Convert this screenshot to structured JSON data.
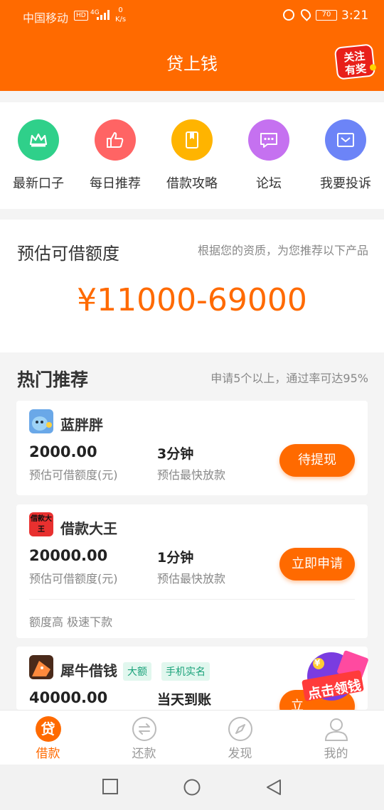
{
  "status_bar": {
    "carrier": "中国移动",
    "hd": "HD",
    "network": "4G",
    "speed_value": "0",
    "speed_unit": "K/s",
    "battery": "70",
    "time": "3:21"
  },
  "header": {
    "title": "贷上钱",
    "follow_badge_line1": "关注",
    "follow_badge_line2": "有奖"
  },
  "quick_menu": [
    {
      "label": "最新口子",
      "icon": "crown-icon",
      "color": "#2fd08a"
    },
    {
      "label": "每日推荐",
      "icon": "thumbs-up-icon",
      "color": "#ff6464"
    },
    {
      "label": "借款攻略",
      "icon": "bookmark-icon",
      "color": "#ffb400"
    },
    {
      "label": "论坛",
      "icon": "chat-icon",
      "color": "#c571f0"
    },
    {
      "label": "我要投诉",
      "icon": "envelope-icon",
      "color": "#6c84f7"
    }
  ],
  "credit": {
    "title": "预估可借额度",
    "note": "根据您的资质，为您推荐以下产品",
    "amount": "¥11000-69000"
  },
  "hot": {
    "title": "热门推荐",
    "note": "申请5个以上，通过率可达95%"
  },
  "products": [
    {
      "name": "蓝胖胖",
      "amount": "2000.00",
      "amount_label": "预估可借额度(元)",
      "speed": "3分钟",
      "speed_label": "预估最快放款",
      "button": "待提现"
    },
    {
      "name": "借款大王",
      "logo_text": "借款大王",
      "amount": "20000.00",
      "amount_label": "预估可借额度(元)",
      "speed": "1分钟",
      "speed_label": "预估最快放款",
      "button": "立即申请",
      "feature": "额度高 极速下款"
    },
    {
      "name": "犀牛借钱",
      "tags": [
        "大额",
        "手机实名"
      ],
      "amount": "40000.00",
      "speed": "当天到账",
      "button_partial": "立"
    }
  ],
  "promo": {
    "text": "点击领钱",
    "small_text": "¥"
  },
  "tabs": [
    {
      "label": "借款",
      "icon": "loan-icon",
      "icon_text": "贷",
      "active": true
    },
    {
      "label": "还款",
      "icon": "repay-icon"
    },
    {
      "label": "发现",
      "icon": "compass-icon"
    },
    {
      "label": "我的",
      "icon": "user-icon"
    }
  ],
  "colors": {
    "brand": "#ff6a00",
    "tag_text": "#1aa27a",
    "tag_bg": "#e1f7ee"
  }
}
